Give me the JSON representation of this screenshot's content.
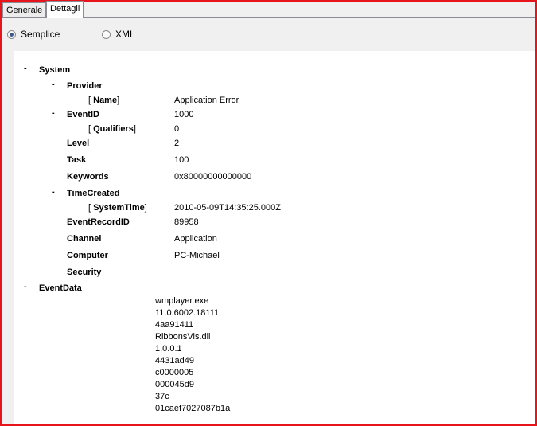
{
  "tabs": [
    "Generale",
    "Dettagli"
  ],
  "view_modes": {
    "simple": "Semplice",
    "xml": "XML",
    "selected": "Semplice"
  },
  "tree": {
    "system": "System",
    "provider": "Provider",
    "name_key": "Name",
    "name_val": "Application Error",
    "eventid": "EventID",
    "eventid_val": "1000",
    "qualifiers_key": "Qualifiers",
    "qualifiers_val": "0",
    "level": "Level",
    "level_val": "2",
    "task": "Task",
    "task_val": "100",
    "keywords": "Keywords",
    "keywords_val": "0x80000000000000",
    "timecreated": "TimeCreated",
    "systemtime_key": "SystemTime",
    "systemtime_val": "2010-05-09T14:35:25.000Z",
    "eventrecordid": "EventRecordID",
    "eventrecordid_val": "89958",
    "channel": "Channel",
    "channel_val": "Application",
    "computer": "Computer",
    "computer_val": "PC-Michael",
    "security": "Security",
    "eventdata": "EventData",
    "eventdata_values": [
      "wmplayer.exe",
      "11.0.6002.18111",
      "4aa91411",
      "RibbonsVis.dll",
      "1.0.0.1",
      "4431ad49",
      "c0000005",
      "000045d9",
      "37c",
      "01caef7027087b1a"
    ]
  }
}
